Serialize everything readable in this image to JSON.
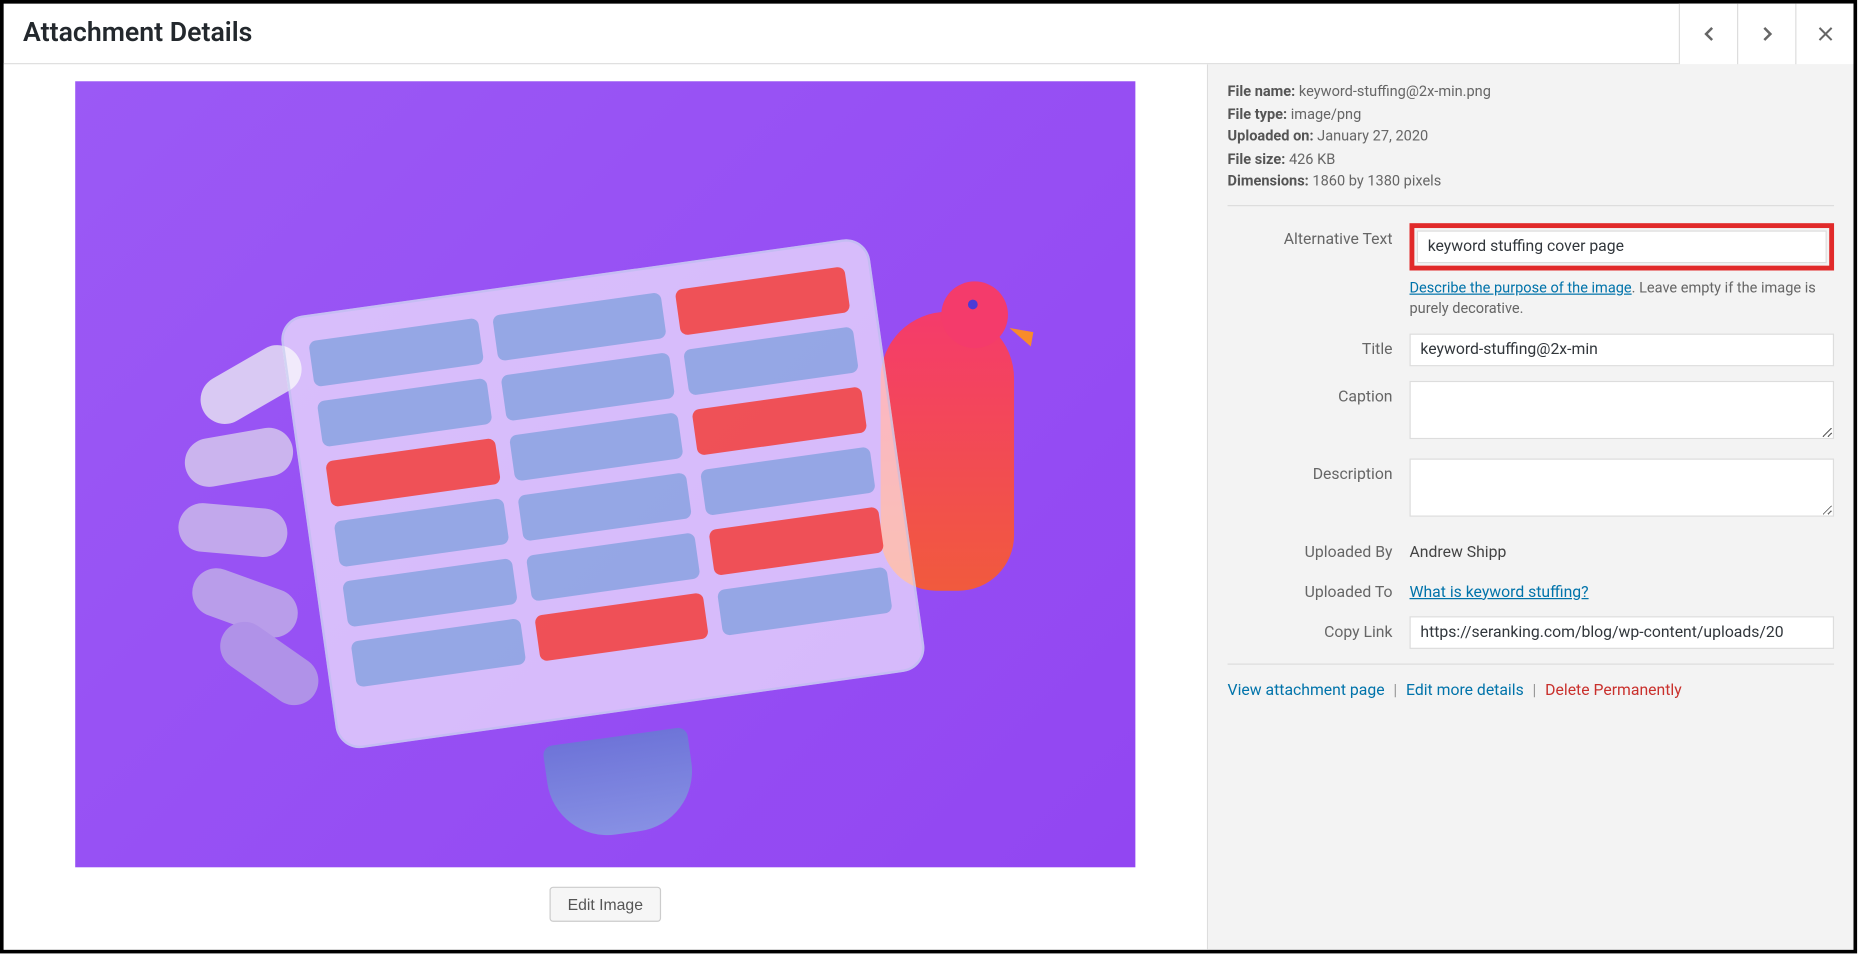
{
  "header": {
    "title": "Attachment Details"
  },
  "meta": {
    "filename_label": "File name:",
    "filename": "keyword-stuffing@2x-min.png",
    "filetype_label": "File type:",
    "filetype": "image/png",
    "uploaded_label": "Uploaded on:",
    "uploaded": "January 27, 2020",
    "filesize_label": "File size:",
    "filesize": "426 KB",
    "dimensions_label": "Dimensions:",
    "dimensions": "1860 by 1380 pixels"
  },
  "fields": {
    "alt_label": "Alternative Text",
    "alt_value": "keyword stuffing cover page",
    "alt_help_link": "Describe the purpose of the image",
    "alt_help_rest": ". Leave empty if the image is purely decorative.",
    "title_label": "Title",
    "title_value": "keyword-stuffing@2x-min",
    "caption_label": "Caption",
    "caption_value": "",
    "description_label": "Description",
    "description_value": "",
    "uploadedby_label": "Uploaded By",
    "uploadedby_value": "Andrew Shipp",
    "uploadedto_label": "Uploaded To",
    "uploadedto_value": "What is keyword stuffing?",
    "copylink_label": "Copy Link",
    "copylink_value": "https://seranking.com/blog/wp-content/uploads/20"
  },
  "actions": {
    "edit_image": "Edit Image",
    "view": "View attachment page",
    "edit_more": "Edit more details",
    "delete": "Delete Permanently"
  }
}
